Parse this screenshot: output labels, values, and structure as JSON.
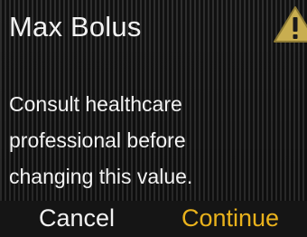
{
  "dialog": {
    "title": "Max Bolus",
    "warning_icon": "warning-triangle-icon",
    "message_lines": [
      "Consult healthcare",
      "professional before",
      "changing this value."
    ]
  },
  "actions": {
    "cancel_label": "Cancel",
    "continue_label": "Continue"
  },
  "colors": {
    "text": "#f2f2f2",
    "accent": "#e9b21c",
    "warning_fill": "#c9ae50"
  }
}
